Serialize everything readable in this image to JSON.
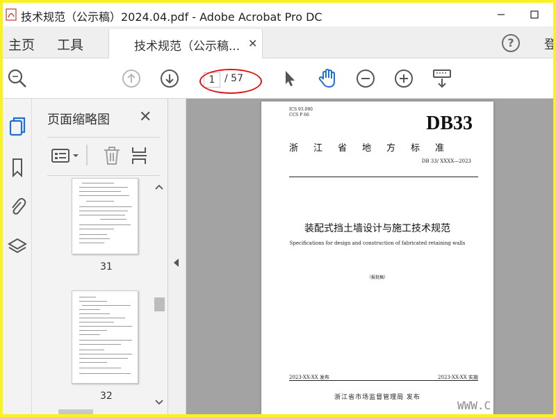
{
  "window": {
    "title": "技术规范（公示稿）2024.04.pdf - Adobe Acrobat Pro DC"
  },
  "menubar": {
    "home_label": "主页",
    "tools_label": "工具",
    "doc_tab_label": "技术规范（公示稿...",
    "signin_label": "登"
  },
  "toolbar": {
    "current_page": "1",
    "total_pages": "/ 57"
  },
  "panel": {
    "title": "页面缩略图",
    "thumbnails": [
      {
        "page_number": "31"
      },
      {
        "page_number": "32"
      }
    ]
  },
  "document": {
    "meta_ics": "ICS 93.080",
    "meta_ccs": "CCS P 66",
    "code": "DB33",
    "std_name": "浙江省地方标准",
    "std_no": "DB 33/ XXXX—2023",
    "title": "装配式挡土墙设计与施工技术规范",
    "subtitle": "Specifications for design and construction of fabricated retaining walls",
    "status": "（报批稿）",
    "pub_date": "2023-XX-XX 发布",
    "impl_date": "2023-XX-XX 实施",
    "issuer": "浙江省市场监督管理局    发布"
  },
  "watermark": "WWW.C",
  "colors": {
    "frame": "#f7f222",
    "hand_tool": "#1e6fd0",
    "oval": "#e01515",
    "doc_bg": "#a3a3a3"
  },
  "icons": [
    "search-icon",
    "page-up-icon",
    "page-down-icon",
    "select-arrow-icon",
    "hand-icon",
    "zoom-out-icon",
    "zoom-in-icon",
    "keyboard-scroll-icon",
    "thumbnails-icon",
    "bookmark-icon",
    "attachment-icon",
    "layers-icon",
    "options-icon",
    "delete-icon",
    "insert-icon"
  ]
}
